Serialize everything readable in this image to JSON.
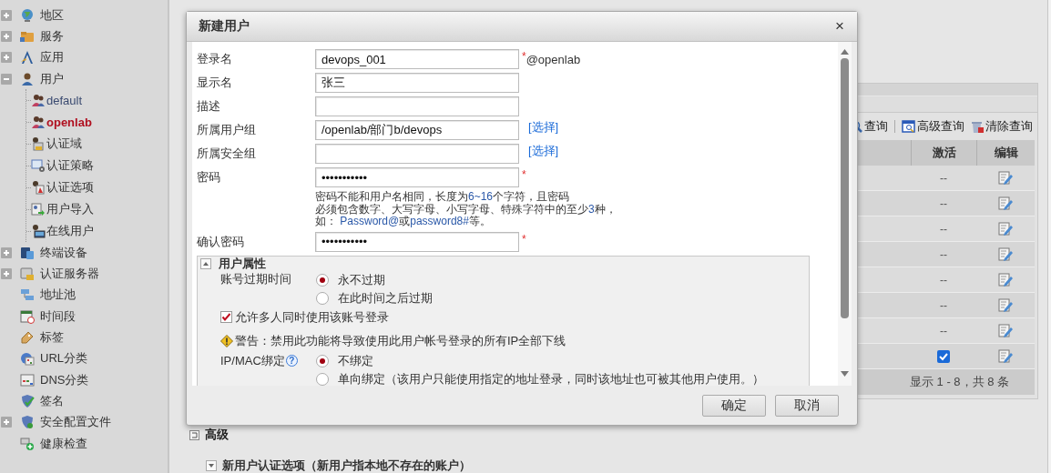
{
  "background": {
    "advanced": "高级",
    "new_user_section": {
      "title": "新用户认证选项（新用户指本地不存在的账户）",
      "expanded": false
    }
  },
  "sidebar": {
    "items": [
      {
        "label": "地区",
        "expanded": false
      },
      {
        "label": "服务",
        "expanded": false
      },
      {
        "label": "应用",
        "expanded": false
      },
      {
        "label": "用户",
        "expanded": true,
        "children": [
          {
            "label": "default",
            "selected": false
          },
          {
            "label": "openlab",
            "selected": true
          },
          {
            "label": "认证域",
            "selected": false
          },
          {
            "label": "认证策略",
            "selected": false
          },
          {
            "label": "认证选项",
            "selected": false
          },
          {
            "label": "用户导入",
            "selected": false
          },
          {
            "label": "在线用户",
            "selected": false
          }
        ]
      },
      {
        "label": "终端设备",
        "expanded": false
      },
      {
        "label": "认证服务器",
        "expanded": false
      },
      {
        "label": "地址池"
      },
      {
        "label": "时间段"
      },
      {
        "label": "标签"
      },
      {
        "label": "URL分类"
      },
      {
        "label": "DNS分类"
      },
      {
        "label": "签名"
      },
      {
        "label": "安全配置文件",
        "expanded": false
      },
      {
        "label": "健康检查"
      }
    ]
  },
  "table": {
    "toolbar": [
      "查询",
      "高级查询",
      "清除查询"
    ],
    "columns": [
      "激活",
      "编辑"
    ],
    "rows": [
      {
        "kind": "text",
        "activation": "--"
      },
      {
        "kind": "text",
        "activation": "--"
      },
      {
        "kind": "text",
        "activation": "--"
      },
      {
        "kind": "text",
        "activation": "--"
      },
      {
        "kind": "text",
        "activation": "--"
      },
      {
        "kind": "text",
        "activation": "--"
      },
      {
        "kind": "text",
        "activation": "--"
      },
      {
        "kind": "checkbox",
        "checked": true
      }
    ],
    "footer": "显示 1 - 8，共 8 条"
  },
  "dialog": {
    "title": "新建用户",
    "close": "×",
    "fields": [
      {
        "label": "登录名",
        "value": "devops_001",
        "required_mark": "*",
        "suffix": "@openlab"
      },
      {
        "label": "显示名",
        "value": "张三"
      },
      {
        "label": "描述"
      },
      {
        "label": "所属用户组",
        "value": "/openlab/部门b/devops",
        "link": "[选择]"
      },
      {
        "label": "所属安全组",
        "link": "[选择]"
      },
      {
        "label": "密码",
        "value": "•••••••••••",
        "required_mark": "*",
        "hint": [
          [
            {
              "text": "密码不能和用户名相同，长度为",
              "kind": "plain"
            },
            {
              "text": "6~16",
              "kind": "value"
            },
            {
              "text": "个字符，且密码",
              "kind": "plain"
            }
          ],
          [
            {
              "text": "必须包含数字、大写字母、小写字母、特殊字符中的至少",
              "kind": "plain"
            },
            {
              "text": "3",
              "kind": "value"
            },
            {
              "text": "种，",
              "kind": "plain"
            }
          ],
          [
            {
              "text": "如： ",
              "kind": "plain"
            },
            {
              "text": "Password@",
              "kind": "value"
            },
            {
              "text": "或",
              "kind": "plain"
            },
            {
              "text": "password8#",
              "kind": "value"
            },
            {
              "text": "等。",
              "kind": "plain"
            }
          ]
        ]
      },
      {
        "label": "确认密码",
        "value": "•••••••••••",
        "required_mark": "*"
      }
    ],
    "properties": {
      "title": "用户属性",
      "expanded": true,
      "expiry": {
        "label": "账号过期时间",
        "options": [
          {
            "label": "永不过期",
            "selected": true
          },
          {
            "label": "在此时间之后过期",
            "selected": false
          }
        ]
      },
      "multi_login": {
        "label": "允许多人同时使用该账号登录",
        "checked": true
      },
      "warning": "警告：禁用此功能将导致使用此用户帐号登录的所有IP全部下线",
      "binding": {
        "label": "IP/MAC绑定",
        "help": "?",
        "options": [
          {
            "label": "不绑定",
            "selected": true
          },
          {
            "label": "单向绑定（该用户只能使用指定的地址登录，同时该地址也可被其他用户使用。）",
            "selected": false
          }
        ]
      }
    },
    "buttons": [
      "确定",
      "取消"
    ]
  }
}
